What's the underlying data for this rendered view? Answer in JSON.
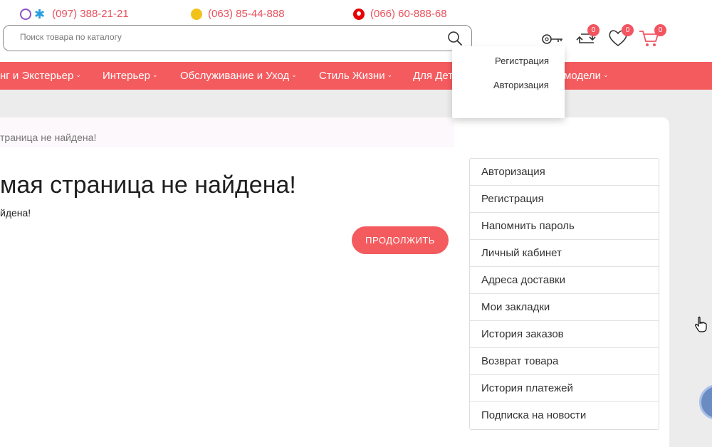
{
  "header": {
    "phones": [
      {
        "number": "(097) 388-21-21",
        "icon": "viber-kyivstar-icon"
      },
      {
        "number": "(063) 85-44-888",
        "icon": "lifecell-icon"
      },
      {
        "number": "(066) 60-888-68",
        "icon": "vodafone-icon"
      }
    ],
    "search": {
      "placeholder": "Поиск товара по каталогу"
    },
    "compare_count": "0",
    "wishlist_count": "0",
    "cart_count": "0"
  },
  "account_dropdown": {
    "items": [
      "Регистрация",
      "Авторизация"
    ]
  },
  "nav": {
    "items": [
      "нг и Экстерьер",
      "Интерьер",
      "Обслуживание и Уход",
      "Стиль Жизни",
      "Для Дет",
      "модели"
    ],
    "chevron": "⌄"
  },
  "breadcrumb": "траница не найдена!",
  "page_title": "мая страница не найдена!",
  "page_text": "йдена!",
  "continue_button": "ПРОДОЛЖИТЬ",
  "account_menu": [
    "Авторизация",
    "Регистрация",
    "Напомнить пароль",
    "Личный кабинет",
    "Адреса доставки",
    "Мои закладки",
    "История заказов",
    "Возврат товара",
    "История платежей",
    "Подписка на новости"
  ],
  "colors": {
    "accent": "#f45b5f",
    "phone_text": "#e8505b"
  }
}
